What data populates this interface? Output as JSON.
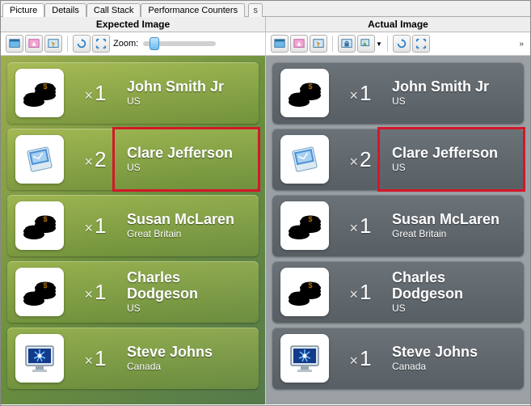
{
  "tabs": {
    "t0": "Picture",
    "t1": "Details",
    "t2": "Call Stack",
    "t3": "Performance Counters",
    "extra": "s"
  },
  "headers": {
    "expected": "Expected Image",
    "actual": "Actual Image"
  },
  "toolbar": {
    "zoom_label": "Zoom:"
  },
  "people": [
    {
      "name": "John Smith Jr",
      "loc": "US",
      "count": "1",
      "icon": "coins",
      "hl": false
    },
    {
      "name": "Clare Jefferson",
      "loc": "US",
      "count": "2",
      "icon": "book",
      "hl": true
    },
    {
      "name": "Susan McLaren",
      "loc": "Great Britain",
      "count": "1",
      "icon": "coins",
      "hl": false
    },
    {
      "name": "Charles Dodgeson",
      "loc": "US",
      "count": "1",
      "icon": "coins",
      "hl": false
    },
    {
      "name": "Steve Johns",
      "loc": "Canada",
      "count": "1",
      "icon": "monitor",
      "hl": false
    }
  ]
}
